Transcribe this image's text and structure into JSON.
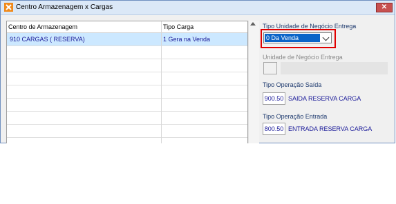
{
  "window": {
    "title": "Centro Armazenagem x Cargas",
    "close_label": "✕"
  },
  "grid": {
    "columns": [
      "Centro de Armazenagem",
      "Tipo Carga"
    ],
    "rows": [
      {
        "centro": "910   CARGAS ( RESERVA)",
        "tipo": "1 Gera na Venda",
        "selected": true
      }
    ],
    "empty_rows": 7
  },
  "form": {
    "tipo_unidade_label": "Tipo Unidade de Negócio Entrega",
    "tipo_unidade_value": "0 Da Venda",
    "unidade_label": "Unidade de Negócio Entrega",
    "tipo_saida_label": "Tipo Operação Saída",
    "saida_code": "900.50",
    "saida_desc": "SAIDA RESERVA CARGA",
    "tipo_entrada_label": "Tipo Operação Entrada",
    "entrada_code": "800.50",
    "entrada_desc": "ENTRADA RESERVA CARGA"
  },
  "colors": {
    "accent": "#0a64c8",
    "highlight": "#e00000",
    "value_text": "#1a1a99"
  },
  "icons": {
    "app": "app-logo-icon",
    "close": "close-icon",
    "dropdown": "chevron-down-icon"
  }
}
